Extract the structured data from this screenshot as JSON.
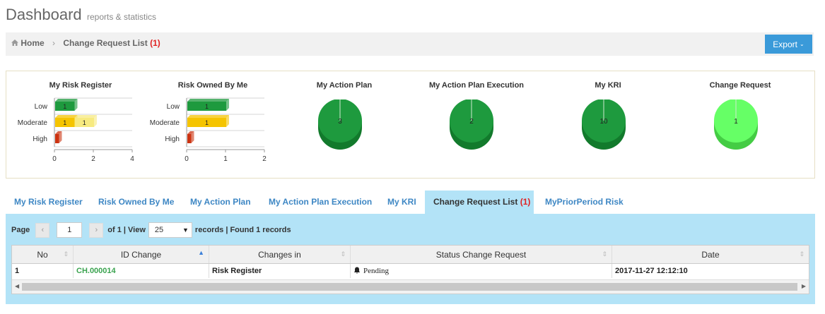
{
  "header": {
    "title": "Dashboard",
    "subtitle": "reports & statistics"
  },
  "breadcrumb": {
    "home": "Home",
    "current": "Change Request List",
    "count": "(1)"
  },
  "export_label": "Export",
  "charts": [
    {
      "type": "bar",
      "title": "My Risk Register",
      "categories": [
        "Low",
        "Moderate",
        "High"
      ],
      "series": [
        {
          "values": [
            1,
            1,
            0.2
          ],
          "colors": [
            "#1e9a3e",
            "#f5c400",
            "#cc3311"
          ],
          "labels": [
            "1",
            "1",
            ""
          ]
        },
        {
          "values": [
            0,
            1,
            0
          ],
          "colors": [
            "#1e9a3e",
            "#f7ea80",
            "#cc3311"
          ],
          "labels": [
            "",
            "1",
            ""
          ]
        }
      ],
      "xlim": [
        0,
        4
      ],
      "xticks": [
        "0",
        "2",
        "4"
      ]
    },
    {
      "type": "bar",
      "title": "Risk Owned By Me",
      "categories": [
        "Low",
        "Moderate",
        "High"
      ],
      "series": [
        {
          "values": [
            1,
            1,
            0.1
          ],
          "colors": [
            "#1e9a3e",
            "#f5c400",
            "#cc3311"
          ],
          "labels": [
            "1",
            "1",
            ""
          ]
        }
      ],
      "xlim": [
        0,
        2
      ],
      "xticks": [
        "0",
        "1",
        "2"
      ]
    },
    {
      "type": "pie",
      "title": "My Action Plan",
      "value": "3",
      "color": "#1e9a3e",
      "shade": "#127a2c"
    },
    {
      "type": "pie",
      "title": "My Action Plan Execution",
      "value": "2",
      "color": "#1e9a3e",
      "shade": "#127a2c"
    },
    {
      "type": "pie",
      "title": "My KRI",
      "value": "10",
      "color": "#1e9a3e",
      "shade": "#127a2c"
    },
    {
      "type": "pie",
      "title": "Change Request",
      "value": "1",
      "color": "#66ff66",
      "shade": "#44cc44"
    }
  ],
  "tabs": [
    {
      "label": "My Risk Register"
    },
    {
      "label": "Risk Owned By Me"
    },
    {
      "label": "My Action Plan"
    },
    {
      "label": "My Action Plan Execution"
    },
    {
      "label": "My KRI"
    },
    {
      "label": "Change Request List",
      "count": "(1)",
      "active": true
    },
    {
      "label": "MyPriorPeriod Risk"
    }
  ],
  "pager": {
    "page_label": "Page",
    "page_value": "1",
    "of_text": "of 1 | View",
    "view_value": "25",
    "records_text": "records | Found 1 records"
  },
  "grid": {
    "columns": [
      "No",
      "ID Change",
      "Changes in",
      "Status Change Request",
      "Date"
    ],
    "rows": [
      {
        "no": "1",
        "id": "CH.000014",
        "changes_in": "Risk Register",
        "status": "Pending",
        "date": "2017-11-27 12:12:10"
      }
    ]
  }
}
